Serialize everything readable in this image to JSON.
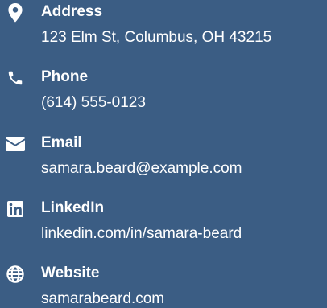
{
  "contact": {
    "items": [
      {
        "icon": "map-pin-icon",
        "label": "Address",
        "value": "123 Elm St, Columbus, OH 43215"
      },
      {
        "icon": "phone-icon",
        "label": "Phone",
        "value": "(614) 555-0123"
      },
      {
        "icon": "envelope-icon",
        "label": "Email",
        "value": "samara.beard@example.com"
      },
      {
        "icon": "linkedin-icon",
        "label": "LinkedIn",
        "value": "linkedin.com/in/samara-beard"
      },
      {
        "icon": "globe-icon",
        "label": "Website",
        "value": "samarabeard.com"
      }
    ]
  },
  "colors": {
    "background": "#3b5d84",
    "text": "#ffffff"
  }
}
